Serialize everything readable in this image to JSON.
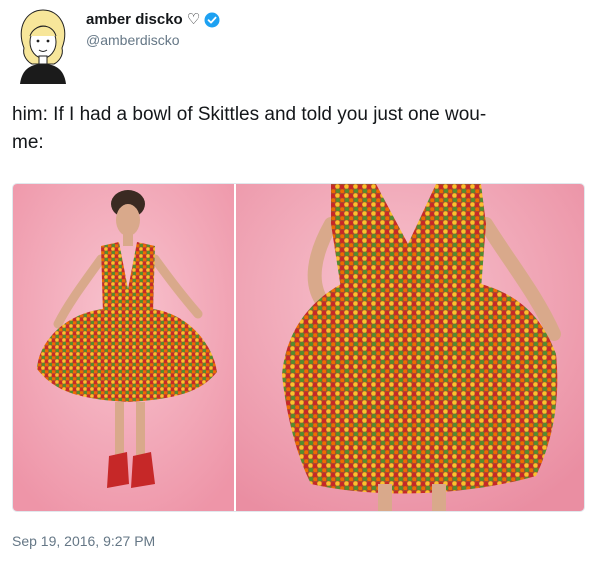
{
  "user": {
    "display_name": "amber discko",
    "heart_glyph": "♡",
    "handle": "@amberdiscko"
  },
  "tweet": {
    "text": "him: If I had a bowl of Skittles and told you just one wou-\nme:"
  },
  "timestamp": "Sep 19, 2016, 9:27 PM",
  "colors": {
    "verified": "#1da1f2",
    "muted_text": "#657786",
    "border": "#e1e8ed",
    "photo_background": "#f2a3b4",
    "skittle_red": "#c62828",
    "skittle_orange": "#ef6c00",
    "skittle_yellow": "#fbc02d",
    "skittle_green": "#558b2f",
    "skittle_purple": "#6a1b4d"
  },
  "icons": {
    "verified": "verified-badge-icon",
    "heart": "heart-outline-icon"
  }
}
